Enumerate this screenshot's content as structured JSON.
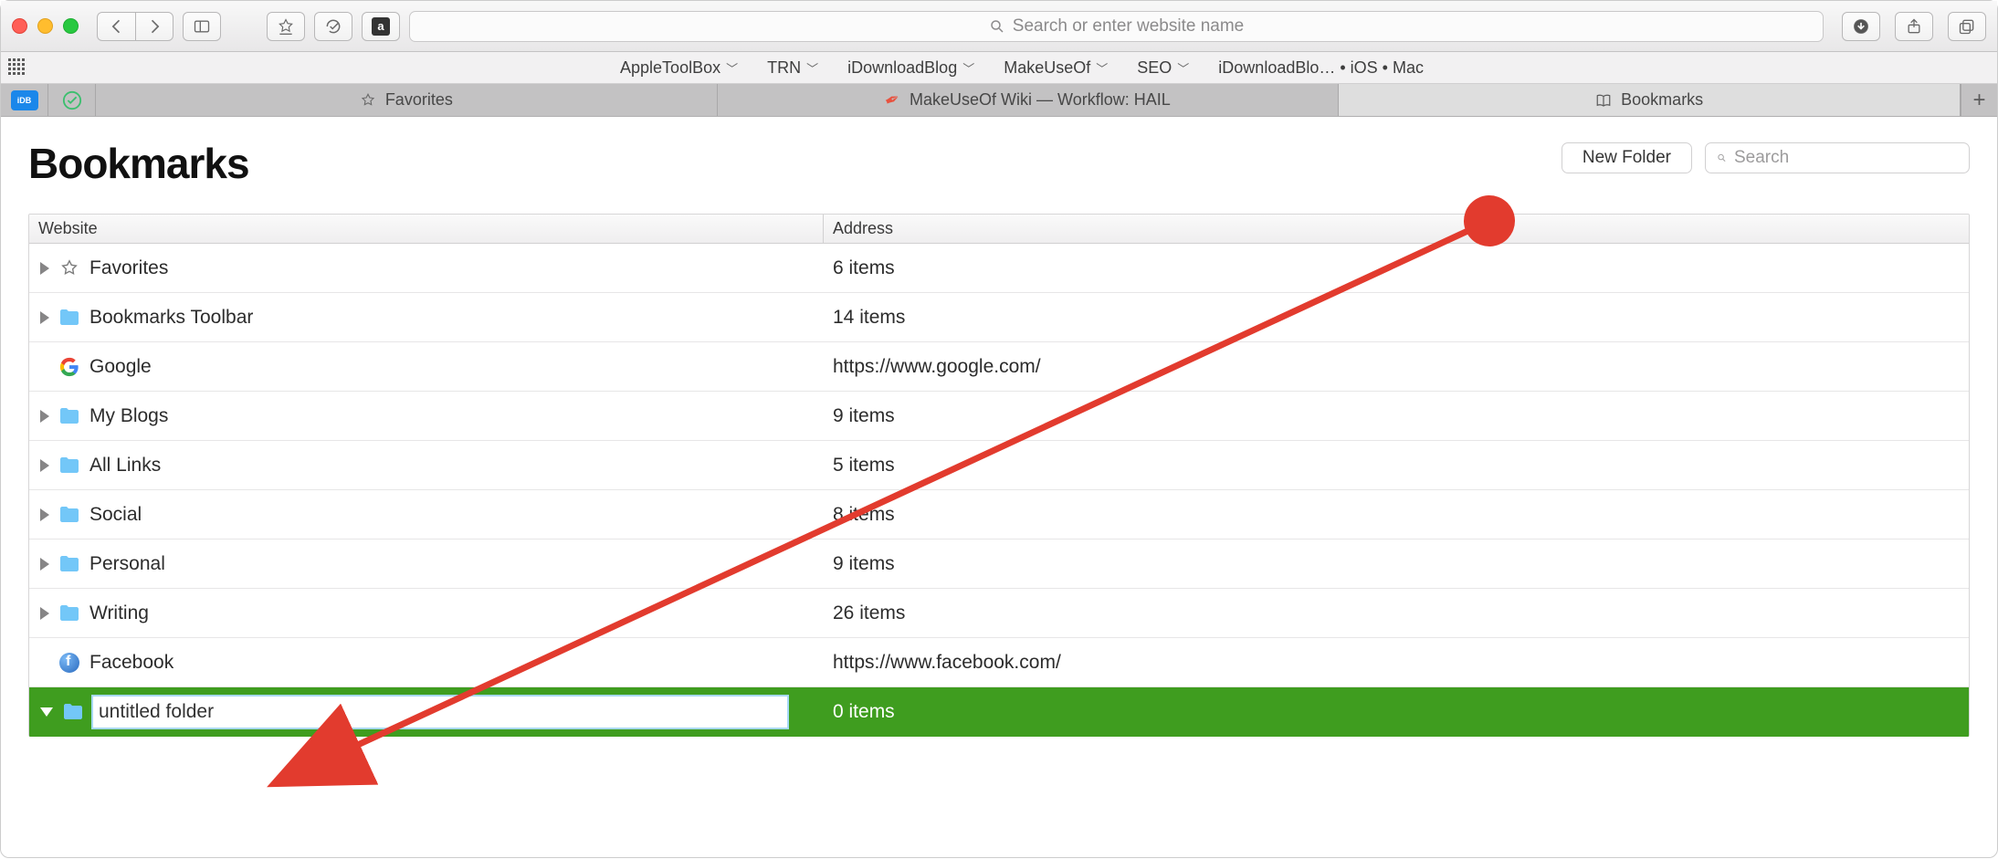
{
  "toolbar": {
    "address_placeholder": "Search or enter website name",
    "idb_label": "iDB"
  },
  "favorites_bar": {
    "items": [
      {
        "label": "AppleToolBox",
        "has_menu": true
      },
      {
        "label": "TRN",
        "has_menu": true
      },
      {
        "label": "iDownloadBlog",
        "has_menu": true
      },
      {
        "label": "MakeUseOf",
        "has_menu": true
      },
      {
        "label": "SEO",
        "has_menu": true
      },
      {
        "label": "iDownloadBlo… • iOS • Mac",
        "has_menu": false
      }
    ]
  },
  "tabs": [
    {
      "label": "Favorites",
      "icon": "star",
      "active": false
    },
    {
      "label": "MakeUseOf Wiki — Workflow: HAIL",
      "icon": "quill",
      "active": false
    },
    {
      "label": "Bookmarks",
      "icon": "book",
      "active": true
    }
  ],
  "page": {
    "title": "Bookmarks",
    "new_folder_label": "New Folder",
    "search_placeholder": "Search"
  },
  "table": {
    "columns": {
      "website": "Website",
      "address": "Address"
    },
    "rows": [
      {
        "kind": "folder",
        "icon": "star",
        "name": "Favorites",
        "address": "6 items",
        "expandable": true
      },
      {
        "kind": "folder",
        "icon": "folder",
        "name": "Bookmarks Toolbar",
        "address": "14 items",
        "expandable": true
      },
      {
        "kind": "link",
        "icon": "google",
        "name": "Google",
        "address": "https://www.google.com/",
        "expandable": false
      },
      {
        "kind": "folder",
        "icon": "folder",
        "name": "My Blogs",
        "address": "9 items",
        "expandable": true
      },
      {
        "kind": "folder",
        "icon": "folder",
        "name": "All Links",
        "address": "5 items",
        "expandable": true
      },
      {
        "kind": "folder",
        "icon": "folder",
        "name": "Social",
        "address": "8 items",
        "expandable": true
      },
      {
        "kind": "folder",
        "icon": "folder",
        "name": "Personal",
        "address": "9 items",
        "expandable": true
      },
      {
        "kind": "folder",
        "icon": "folder",
        "name": "Writing",
        "address": "26 items",
        "expandable": true
      },
      {
        "kind": "link",
        "icon": "facebook",
        "name": "Facebook",
        "address": "https://www.facebook.com/",
        "expandable": false
      },
      {
        "kind": "edit-folder",
        "icon": "folder",
        "name": "untitled folder",
        "address": "0 items",
        "expandable": true,
        "selected": true
      }
    ]
  }
}
